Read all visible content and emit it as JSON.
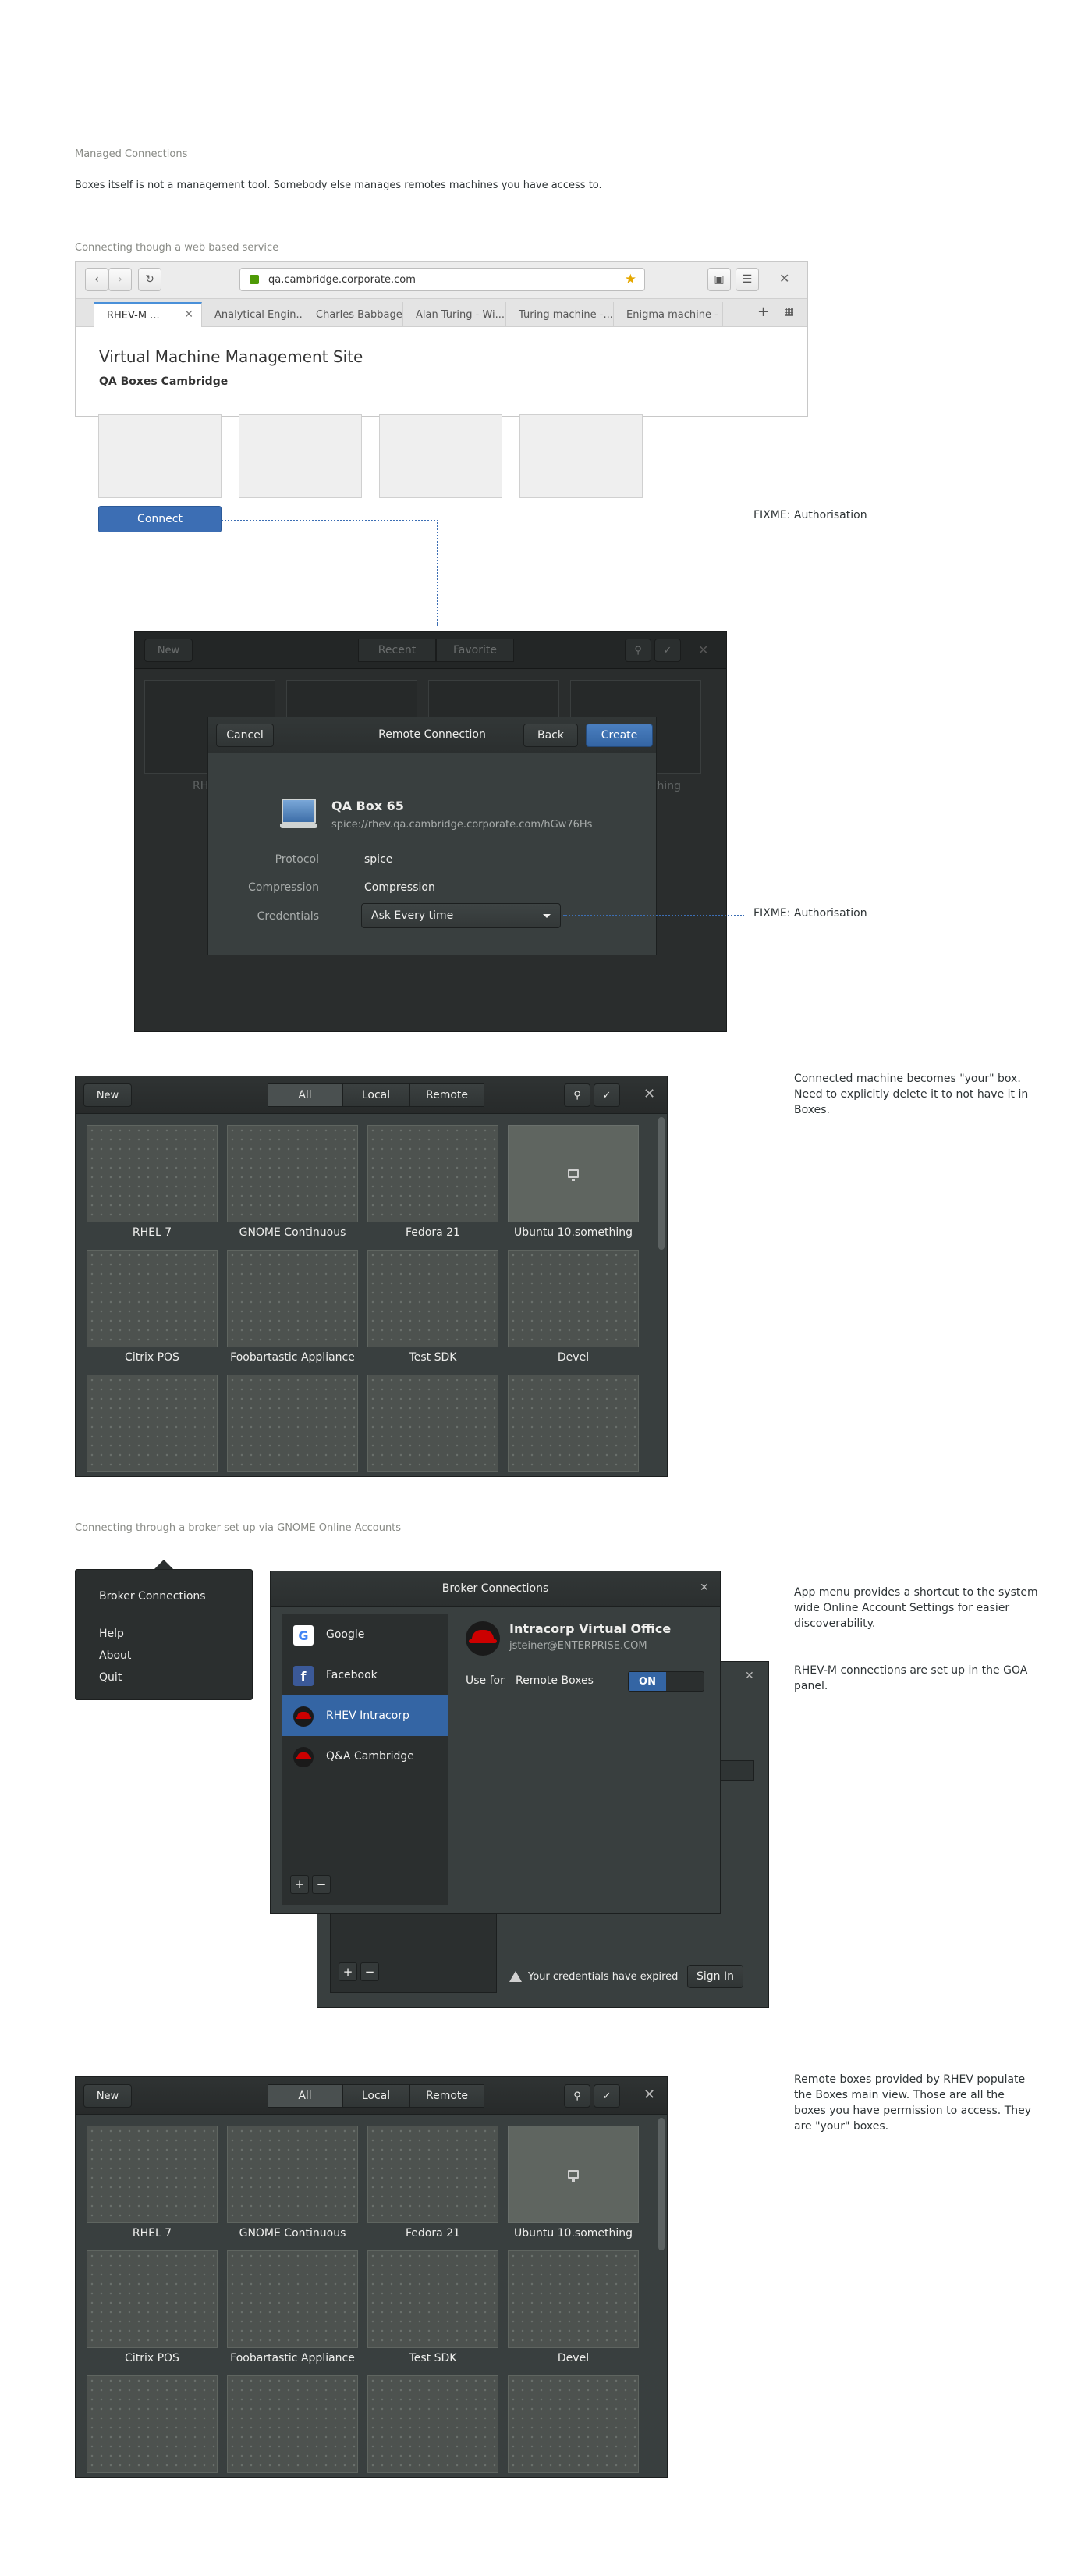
{
  "intro": {
    "title": "Managed Connections",
    "description": "Boxes itself is not a management tool. Somebody else manages remotes machines you have access to."
  },
  "web_section": {
    "title": "Connecting though a web based service",
    "browser": {
      "url": "qa.cambridge.corporate.com",
      "tabs": [
        "RHEV-M ...",
        "Analytical Engin...",
        "Charles Babbage...",
        "Alan Turing - Wi...",
        "Turing machine -...",
        "Enigma machine -"
      ],
      "page_title": "Virtual Machine Management Site",
      "page_subtitle": "QA Boxes Cambridge",
      "connect_label": "Connect"
    }
  },
  "remote_dialog": {
    "bg_new": "New",
    "bg_recent": "Recent",
    "bg_favorite": "Favorite",
    "bg_label_left": "RH",
    "bg_label_right": "thing",
    "cancel": "Cancel",
    "title": "Remote Connection",
    "back": "Back",
    "create": "Create",
    "vm_name": "QA Box 65",
    "vm_uri": "spice://rhev.qa.cambridge.corporate.com/hGw76Hs",
    "protocol_label": "Protocol",
    "protocol_value": "spice",
    "compression_label": "Compression",
    "compression_value": "Compression",
    "credentials_label": "Credentials",
    "credentials_value": "Ask Every time"
  },
  "notes": {
    "fixme_1": "FIXME: Authorisation",
    "fixme_2": "FIXME: Authorisation",
    "connected": "Connected machine becomes \"your\" box.\nNeed to explicitly delete it to not have it in\nBoxes.",
    "app_menu_1": "App menu provides a shortcut to the system\nwide Online Account Settings for easier\ndiscoverability.",
    "app_menu_2": "RHEV-M connections are set up in the GOA\npanel.",
    "remote_boxes": "Remote boxes provided by RHEV populate\nthe Boxes main view. Those are all the\nboxes you have permission to access. They\nare \"your\" boxes."
  },
  "boxes_view": {
    "new": "New",
    "filters": [
      "All",
      "Local",
      "Remote"
    ],
    "machines": [
      "RHEL 7",
      "GNOME Continuous",
      "Fedora 21",
      "Ubuntu 10.something",
      "Citrix POS",
      "Foobartastic Appliance",
      "Test SDK",
      "Devel"
    ]
  },
  "broker_section": {
    "title": "Connecting through a broker set up via GNOME Online Accounts",
    "menu": {
      "items": [
        "Broker Connections",
        "Help",
        "About",
        "Quit"
      ]
    },
    "dialog": {
      "title": "Broker Connections",
      "accounts": [
        "Google",
        "Facebook",
        "RHEV Intracorp",
        "Q&A Cambridge"
      ],
      "account_name": "Intracorp Virtual Office",
      "account_email": "jsteiner@ENTERPRISE.COM",
      "use_for": "Use for",
      "remote_boxes": "Remote Boxes",
      "switch_on": "ON",
      "expired": "Your credentials have expired",
      "sign_in": "Sign In"
    }
  },
  "colors": {
    "accent": "#3465a4",
    "dark_bg": "#393f3f",
    "headerbar": "#2b2f2f",
    "dotted_line": "#3c6eb4"
  }
}
